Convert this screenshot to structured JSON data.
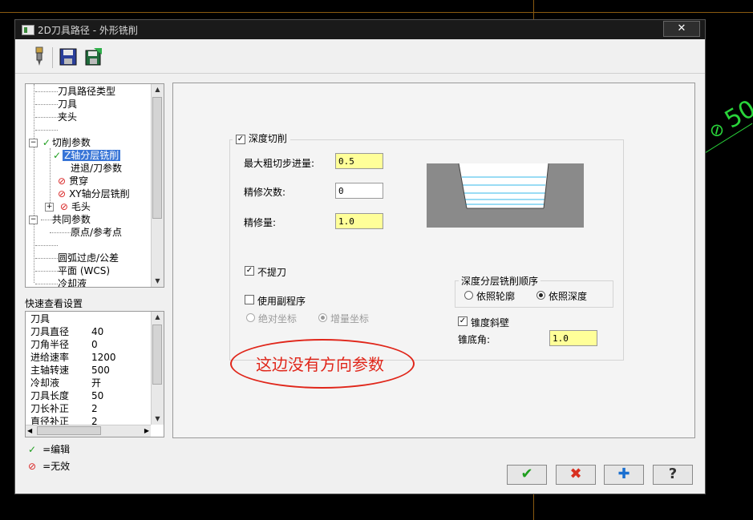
{
  "window": {
    "title": "2D刀具路径 - 外形铣削",
    "close_label": "✕"
  },
  "toolbar": {
    "icons": [
      "tool-icon",
      "save-icon",
      "save-export-icon"
    ]
  },
  "tree": {
    "items": [
      {
        "label": "刀具路径类型",
        "status": ""
      },
      {
        "label": "刀具",
        "status": ""
      },
      {
        "label": "夹头",
        "status": ""
      },
      {
        "label": "",
        "status": ""
      },
      {
        "label": "切削参数",
        "status": "edit",
        "expander": "−"
      },
      {
        "label": "Z轴分层铣削",
        "status": "edit",
        "selected": true
      },
      {
        "label": "进退/刀参数",
        "status": ""
      },
      {
        "label": "贯穿",
        "status": "invalid"
      },
      {
        "label": "XY轴分层铣削",
        "status": "invalid"
      },
      {
        "label": "毛头",
        "status": "invalid",
        "expander": "+"
      },
      {
        "label": "共同参数",
        "status": "",
        "expander": "−"
      },
      {
        "label": "原点/参考点",
        "status": ""
      },
      {
        "label": "",
        "status": ""
      },
      {
        "label": "圆弧过虑/公差",
        "status": ""
      },
      {
        "label": "平面 (WCS)",
        "status": ""
      },
      {
        "label": "冷却液",
        "status": ""
      }
    ]
  },
  "quick_view": {
    "title": "快速查看设置",
    "header": "刀具",
    "rows": [
      {
        "label": "刀具直径",
        "value": "40"
      },
      {
        "label": "刀角半径",
        "value": "0"
      },
      {
        "label": "进给速率",
        "value": "1200"
      },
      {
        "label": "主轴转速",
        "value": "500"
      },
      {
        "label": "冷却液",
        "value": "开"
      },
      {
        "label": "刀具长度",
        "value": "50"
      },
      {
        "label": "刀长补正",
        "value": "2"
      },
      {
        "label": "直径补正",
        "value": "2"
      }
    ]
  },
  "legend": {
    "edit": "=编辑",
    "invalid": "=无效"
  },
  "depth_cut": {
    "enabled_label": "深度切削",
    "enabled": true,
    "max_rough_step_label": "最大粗切步进量:",
    "max_rough_step": "0.5",
    "finish_count_label": "精修次数:",
    "finish_count": "0",
    "finish_amount_label": "精修量:",
    "finish_amount": "1.0",
    "no_lift_label": "不提刀",
    "no_lift": true,
    "use_subprogram_label": "使用副程序",
    "use_subprogram": false,
    "absolute_label": "绝对坐标",
    "incremental_label": "增量坐标",
    "order_group_label": "深度分层铣削顺序",
    "by_contour_label": "依照轮廓",
    "by_depth_label": "依照深度",
    "order_selected": "by_depth",
    "taper_wall_label": "锥度斜壁",
    "taper_wall": true,
    "taper_angle_label": "锥底角:",
    "taper_angle": "1.0"
  },
  "annotation": {
    "text": "这边没有方向参数",
    "color": "#e0261a"
  },
  "buttons": {
    "ok": {
      "icon": "checkmark-icon",
      "glyph": "✔",
      "color": "#1e9e1e"
    },
    "cancel": {
      "icon": "x-icon",
      "glyph": "✖",
      "color": "#d83020"
    },
    "add": {
      "icon": "plus-icon",
      "glyph": "✚",
      "color": "#1a6fd0"
    },
    "help": {
      "icon": "help-icon",
      "glyph": "?",
      "color": "#333333"
    }
  },
  "background": {
    "cad_text": "50.0"
  }
}
